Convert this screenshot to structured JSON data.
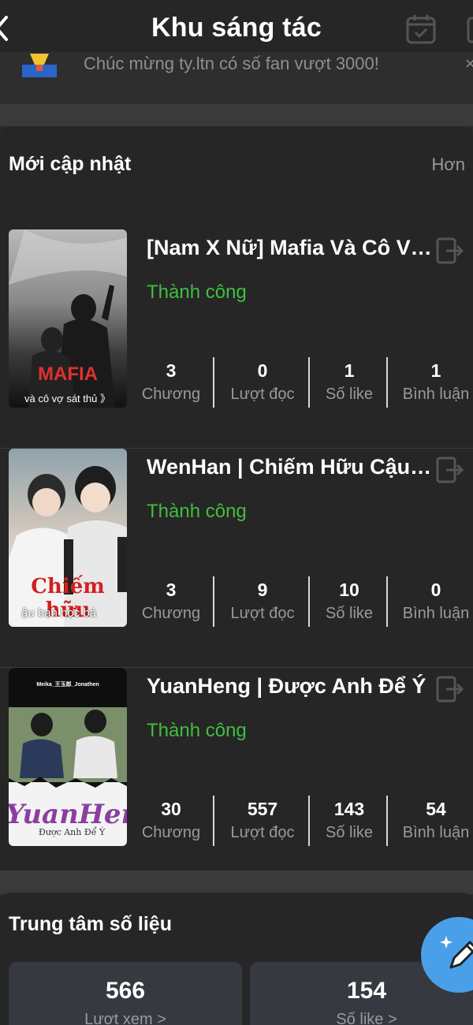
{
  "header": {
    "title": "Khu sáng tác"
  },
  "announcement": {
    "text": "Chúc mừng ty.ltn có số fan vượt 3000!"
  },
  "recent": {
    "title": "Mới cập nhật",
    "more_label": "Hơn",
    "stories": [
      {
        "title": "[Nam X Nữ] Mafia Và Cô Vợ...",
        "status": "Thành công",
        "cover_caption": "và cô vợ sát thủ 》",
        "cover_big_text": "MAFIA",
        "stats": [
          {
            "value": "3",
            "label": "Chương"
          },
          {
            "value": "0",
            "label": "Lượt đọc"
          },
          {
            "value": "1",
            "label": "Số like"
          },
          {
            "value": "1",
            "label": "Bình luận"
          }
        ]
      },
      {
        "title": "WenHan | Chiếm Hữu Cậu ...",
        "status": "Thành công",
        "cover_caption": "ậu bạn học bá",
        "cover_big_text": "Chiếm hữu",
        "stats": [
          {
            "value": "3",
            "label": "Chương"
          },
          {
            "value": "9",
            "label": "Lượt đọc"
          },
          {
            "value": "10",
            "label": "Số like"
          },
          {
            "value": "0",
            "label": "Bình luận"
          }
        ]
      },
      {
        "title": "YuanHeng | Được Anh Để Ý",
        "status": "Thành công",
        "cover_caption": "Được Anh Để Ý",
        "cover_big_text": "YuanHeng",
        "cover_top_text": "Meika_王玉郎_Jonathen",
        "stats": [
          {
            "value": "30",
            "label": "Chương"
          },
          {
            "value": "557",
            "label": "Lượt đọc"
          },
          {
            "value": "143",
            "label": "Số like"
          },
          {
            "value": "54",
            "label": "Bình luận"
          }
        ]
      }
    ]
  },
  "data_center": {
    "title": "Trung tâm số liệu",
    "cards": [
      {
        "value": "566",
        "label": "Lượt xem >"
      },
      {
        "value": "154",
        "label": "Số like >"
      }
    ]
  },
  "colors": {
    "background": "#262626",
    "success": "#3fbf3f",
    "fab": "#4aa0e8"
  },
  "icons": [
    "back-icon",
    "calendar-icon",
    "trophy-icon",
    "exit-icon",
    "edit-icon"
  ]
}
